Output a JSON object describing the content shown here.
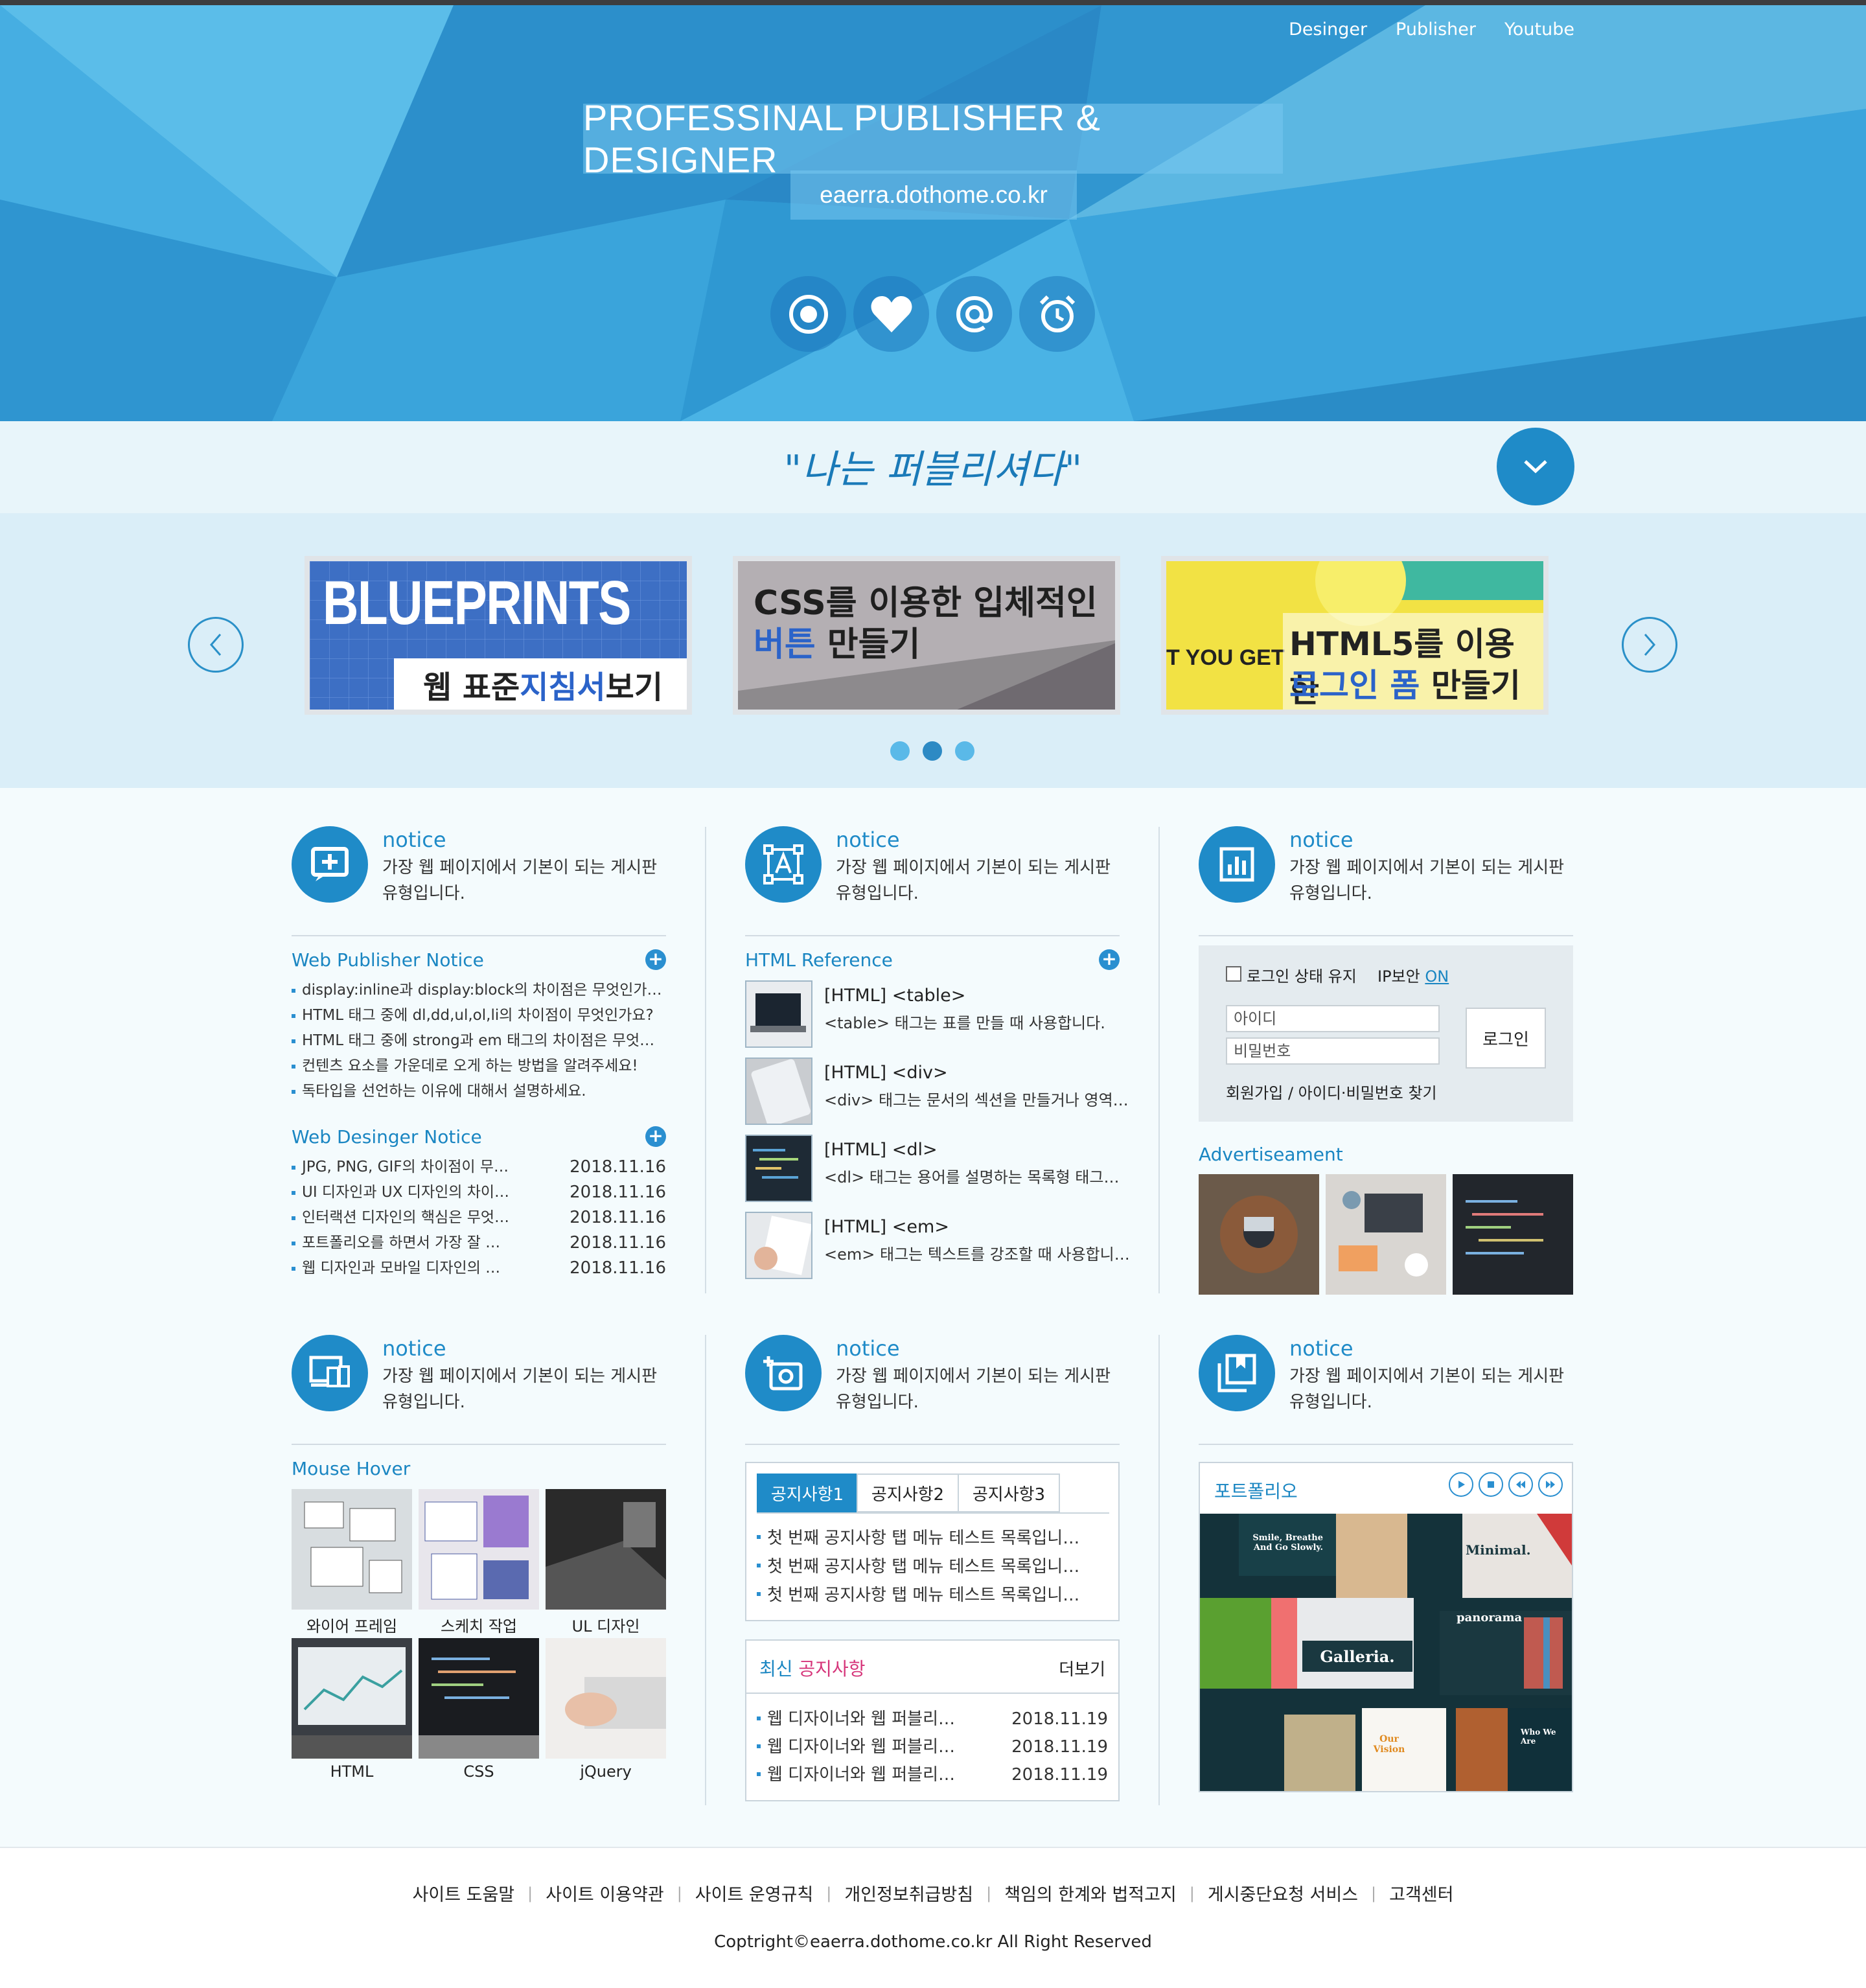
{
  "topnav": [
    "Desinger",
    "Publisher",
    "Youtube"
  ],
  "hero": {
    "title": "PROFESSINAL PUBLISHER & DESIGNER",
    "url": "eaerra.dothome.co.kr",
    "icons": [
      "target-icon",
      "heart-icon",
      "at-icon",
      "alarm-clock-icon"
    ]
  },
  "slogan": "\"나는 퍼블리셔다\"",
  "slides": {
    "s1": {
      "big": "BLUEPRINTS",
      "a": "웹 표준 ",
      "b": "지침서",
      "c": " 보기"
    },
    "s2": {
      "l1": "CSS를 이용한 입체적인",
      "b": "버튼",
      "c": " 만들기"
    },
    "s3": {
      "side": "T YOU GET",
      "l1": "HTML5를 이용한",
      "b": "로그인 폼",
      "c": " 만들기"
    }
  },
  "colors": {
    "accent": "#1f8bc8",
    "hero": "#3ba7de",
    "bg": "#f4fbfd"
  },
  "notice_title": "notice",
  "notice_desc": "가장 웹 페이지에서 기본이 되는 게시판 유형입니다.",
  "pub": {
    "title": "Web Publisher Notice",
    "items": [
      "display:inline과 display:block의 차이점은 무엇인가…",
      "HTML 태그 중에 dl,dd,ul,ol,li의 차이점이 무엇인가요?",
      "HTML 태그 중에 strong과 em 태그의 차이점은 무엇…",
      "컨텐츠 요소를 가운데로 오게 하는 방법을 알려주세요!",
      "독타입을 선언하는 이유에 대해서 설명하세요."
    ]
  },
  "des": {
    "title": "Web Desinger Notice",
    "items": [
      {
        "t": "JPG, PNG, GIF의 차이점이 무…",
        "d": "2018.11.16"
      },
      {
        "t": "UI 디자인과 UX 디자인의 차이…",
        "d": "2018.11.16"
      },
      {
        "t": "인터랙션 디자인의 핵심은 무엇…",
        "d": "2018.11.16"
      },
      {
        "t": "포트폴리오를 하면서 가장 잘 …",
        "d": "2018.11.16"
      },
      {
        "t": "웹 디자인과 모바일 디자인의 …",
        "d": "2018.11.16"
      }
    ]
  },
  "ref": {
    "title": "HTML Reference",
    "items": [
      {
        "h": "[HTML] <table>",
        "p": "<table> 태그는 표를 만들 때 사용합니다."
      },
      {
        "h": "[HTML] <div>",
        "p": "<div> 태그는 문서의 섹션을 만들거나 영역…"
      },
      {
        "h": "[HTML] <dl>",
        "p": "<dl> 태그는 용어를 설명하는 목록형 태그…"
      },
      {
        "h": "[HTML] <em>",
        "p": "<em> 태그는 텍스트를 강조할 때 사용합니…"
      }
    ]
  },
  "login": {
    "keep": "로그인 상태 유지",
    "ip": "IP보안",
    "ip_state": "ON",
    "id": "아이디",
    "pw": "비밀번호",
    "button": "로그인",
    "links": "회원가입 / 아이디·비밀번호 찾기"
  },
  "ad": {
    "title": "Advertiseament"
  },
  "hover": {
    "title": "Mouse Hover",
    "items": [
      "와이어 프레임",
      "스케치 작업",
      "UL 디자인",
      "HTML",
      "CSS",
      "jQuery"
    ]
  },
  "tabs": {
    "labels": [
      "공지사항1",
      "공지사항2",
      "공지사항3"
    ],
    "items": [
      "첫 번째 공지사항 탭 메뉴 테스트 목록입니…",
      "첫 번째 공지사항 탭 메뉴 테스트 목록입니…",
      "첫 번째 공지사항 탭 메뉴 테스트 목록입니…"
    ]
  },
  "news": {
    "title_a": "최신 ",
    "title_b": "공지사항",
    "more": "더보기",
    "items": [
      {
        "t": "웹 디자이너와 웹 퍼블리…",
        "d": "2018.11.19"
      },
      {
        "t": "웹 디자이너와 웹 퍼블리…",
        "d": "2018.11.19"
      },
      {
        "t": "웹 디자이너와 웹 퍼블리…",
        "d": "2018.11.19"
      }
    ]
  },
  "portfolio": {
    "title": "포트폴리오",
    "controls": [
      "play-icon",
      "stop-icon",
      "rewind-icon",
      "forward-icon"
    ],
    "cards": {
      "smile": "Smile, Breathe And Go Slowly.",
      "minimal": "Minimal.",
      "panorama": "panorama",
      "galleria": "Galleria.",
      "vision": "Our Vision",
      "who": "Who We Are"
    }
  },
  "footer": {
    "links": [
      "사이트 도움말",
      "사이트 이용약관",
      "사이트 운영규칙",
      "개인정보취급방침",
      "책임의 한계와 법적고지",
      "게시중단요청 서비스",
      "고객센터"
    ],
    "copyright": "Coptright©eaerra.dothome.co.kr All Right Reserved"
  }
}
